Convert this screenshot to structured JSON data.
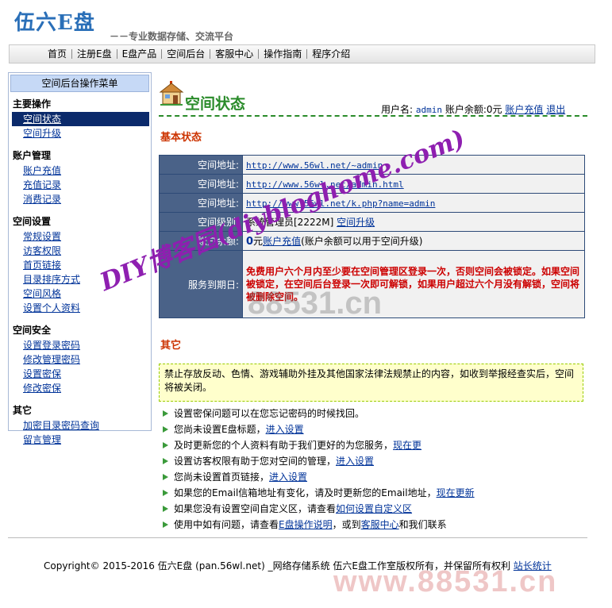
{
  "brand": {
    "logo": "伍六E盘",
    "slogan": "－－专业数据存储、交流平台"
  },
  "nav": [
    "首页",
    "注册E盘",
    "E盘产品",
    "空间后台",
    "客服中心",
    "操作指南",
    "程序介绍"
  ],
  "sidebar": {
    "header": "空间后台操作菜单",
    "groups": [
      {
        "title": "主要操作",
        "items": [
          "空间状态",
          "空间升级"
        ]
      },
      {
        "title": "账户管理",
        "items": [
          "账户充值",
          "充值记录",
          "消费记录"
        ]
      },
      {
        "title": "空间设置",
        "items": [
          "常规设置",
          "访客权限",
          "首页链接",
          "目录排序方式",
          "空间风格",
          "设置个人资料"
        ]
      },
      {
        "title": "空间安全",
        "items": [
          "设置登录密码",
          "修改管理密码",
          "设置密保",
          "修改密保"
        ]
      },
      {
        "title": "其它",
        "items": [
          "加密目录密码查询",
          "留言管理"
        ]
      }
    ]
  },
  "page": {
    "title": "空间状态",
    "user_label": "用户名:",
    "username": "admin",
    "balance_label": "账户余额:",
    "balance": "0元",
    "recharge_link": "账户充值",
    "logout_link": "退出"
  },
  "basic": {
    "section_title": "基本状态",
    "rows": [
      {
        "label": "空间地址:",
        "value": "http://www.56wl.net/~admin"
      },
      {
        "label": "空间地址:",
        "value": "http://www.56wl.net/admin.html"
      },
      {
        "label": "空间地址:",
        "value": "http://www.56wl.net/k.php?name=admin"
      },
      {
        "label": "空间级别:",
        "value": "系统管理员[2222M]",
        "link": "空间升级"
      },
      {
        "label": "账户余额:",
        "amount": "0",
        "amount_suffix": "元",
        "link": "账户充值",
        "note": "(账户余额可以用于空间升级)"
      },
      {
        "label": "服务到期日:",
        "warning": "免费用户六个月内至少要在空间管理区登录一次，否则空间会被锁定。如果空间被锁定，在空间后台登录一次即可解锁，如果用户超过六个月没有解锁，空间将被删除空间。"
      }
    ]
  },
  "tips": {
    "section_title": "其它",
    "notice": "禁止存放反动、色情、游戏辅助外挂及其他国家法律法规禁止的内容，如收到举报经查实后，空间将被关闭。",
    "items": [
      {
        "text": "设置密保问题可以在您忘记密码的时候找回。"
      },
      {
        "text": "您尚未设置E盘标题，",
        "link": "进入设置"
      },
      {
        "text": "及时更新您的个人资料有助于我们更好的为您服务，",
        "link": "现在更"
      },
      {
        "text": "设置访客权限有助于您对空间的管理，",
        "link": "进入设置"
      },
      {
        "text": "您尚未设置首页链接，",
        "link": "进入设置"
      },
      {
        "text": "如果您的Email信箱地址有变化，请及时更新您的Email地址，",
        "link": "现在更新"
      },
      {
        "text": "如果您没有设置空间自定义区，请查看",
        "link": "如何设置自定义区"
      },
      {
        "text": "使用中如有问题，请查看",
        "link": "E盘操作说明",
        "text2": "，或到",
        "link2": "客服中心",
        "text3": "和我们联系"
      }
    ]
  },
  "footer": {
    "text": "Copyright© 2015-2016 伍六E盘 (pan.56wl.net) _网络存储系统 伍六E盘工作室版权所有，并保留所有权利",
    "link": "站长统计"
  },
  "watermarks": {
    "diy": "DIY博客园(diybloghome.com)",
    "site_gray": "88531.cn",
    "site_red": "www.88531.cn"
  }
}
